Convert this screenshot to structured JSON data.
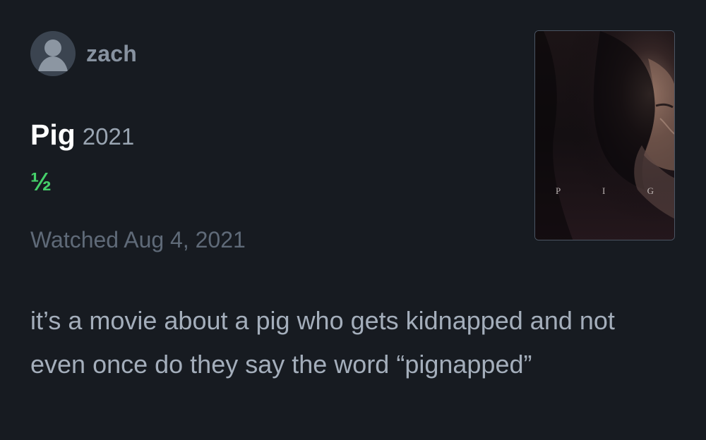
{
  "user": {
    "name": "zach",
    "avatar_icon": "user-avatar-icon"
  },
  "film": {
    "title": "Pig",
    "year": "2021",
    "poster_title": "P I G"
  },
  "rating": {
    "text": "½",
    "value": 0.5,
    "max": 5
  },
  "watched": {
    "text": "Watched Aug 4, 2021"
  },
  "review": {
    "text": "it’s a movie about a pig who gets kidnapped and not even once do they say the word “pignapped”"
  },
  "colors": {
    "background": "#171b21",
    "username": "#8792a0",
    "title": "#ffffff",
    "year": "#9aa5b2",
    "rating": "#45d06a",
    "watched": "#5f6a78",
    "review_text": "#a4aebb"
  }
}
